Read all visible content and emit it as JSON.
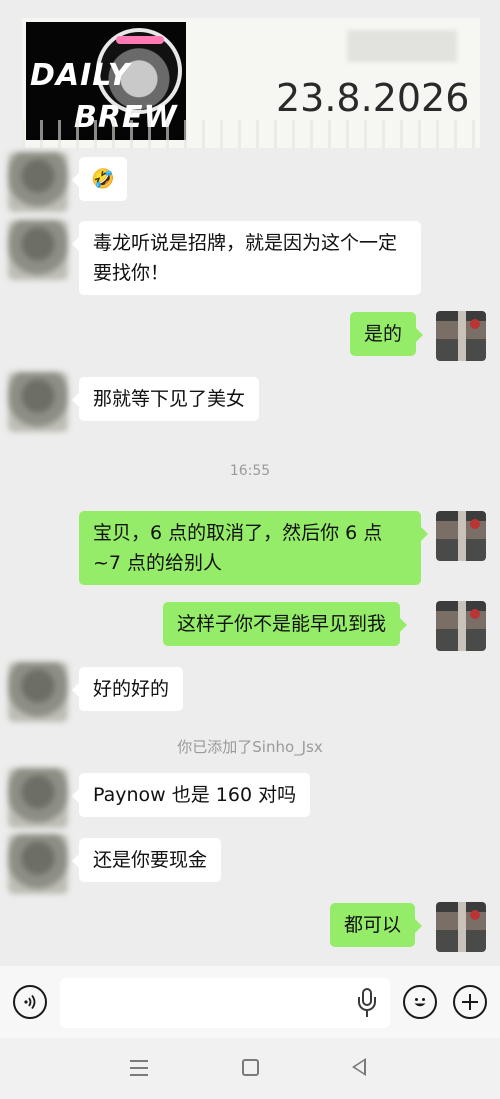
{
  "watermark": {
    "logo_line1": "DAILY",
    "logo_line2": "BREW",
    "date": "23.8.2026"
  },
  "messages": [
    {
      "side": "in",
      "text": "🤣"
    },
    {
      "side": "in",
      "text": "毒龙听说是招牌，就是因为这个一定要找你！"
    },
    {
      "side": "out",
      "text": "是的"
    },
    {
      "side": "in",
      "text": "那就等下见了美女"
    },
    {
      "side": "out",
      "text": "宝贝，6 点的取消了，然后你 6 点~7 点的给别人"
    },
    {
      "side": "out",
      "text": "这样子你不是能早见到我"
    },
    {
      "side": "in",
      "text": "好的好的"
    },
    {
      "side": "in",
      "text": "Paynow 也是 160 对吗"
    },
    {
      "side": "in",
      "text": "还是你要现金"
    },
    {
      "side": "out",
      "text": "都可以"
    }
  ],
  "system": {
    "timestamp": "16:55",
    "added_notice": "你已添加了Sinho_Jsx"
  },
  "input_bar": {
    "voice_icon": "voice-icon",
    "placeholder": "",
    "emoji_icon": "emoji-icon",
    "plus_icon": "plus-icon"
  },
  "colors": {
    "background": "#ededed",
    "incoming_bubble": "#ffffff",
    "outgoing_bubble": "#95ec69"
  }
}
